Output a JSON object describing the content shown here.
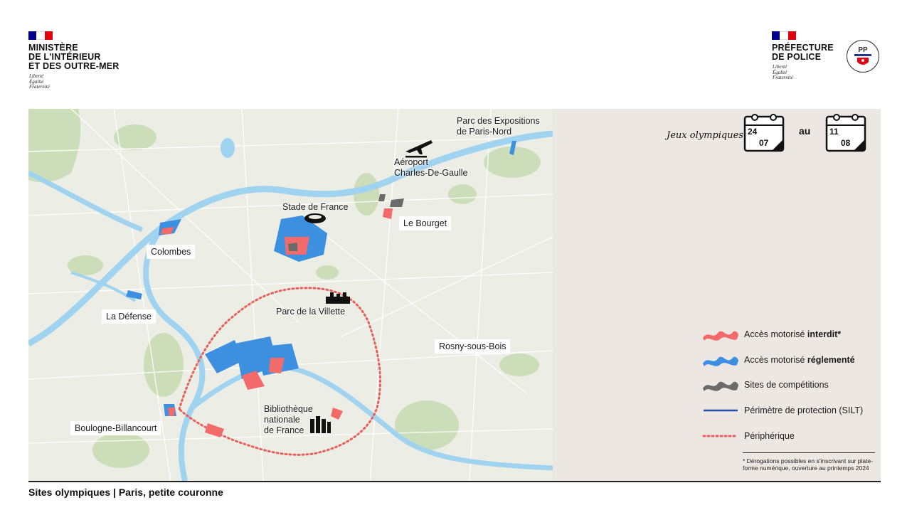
{
  "header": {
    "left": {
      "name_lines": [
        "MINISTÈRE",
        "DE L'INTÉRIEUR",
        "ET DES OUTRE-MER"
      ],
      "motto_lines": [
        "Liberté",
        "Égalité",
        "Fraternité"
      ]
    },
    "right": {
      "name_lines": [
        "PRÉFECTURE",
        "DE POLICE"
      ],
      "motto_lines": [
        "Liberté",
        "Égalité",
        "Fraternité"
      ],
      "logo_text": "PP"
    }
  },
  "dates": {
    "event_label": "Jeux olympiques",
    "connector": "au",
    "start": {
      "day": "24",
      "month": "07"
    },
    "end": {
      "day": "11",
      "month": "08"
    }
  },
  "map": {
    "labels": {
      "parc_expositions": [
        "Parc des Expositions",
        "de Paris-Nord"
      ],
      "aeroport": [
        "Aéroport",
        "Charles-De-Gaulle"
      ],
      "stade_de_france": "Stade de France",
      "le_bourget": "Le Bourget",
      "colombes": "Colombes",
      "la_defense": "La Défense",
      "parc_villette": "Parc de la Villette",
      "rosny": "Rosny-sous-Bois",
      "boulogne": "Boulogne-Billancourt",
      "bibliotheque": [
        "Bibliothèque",
        "nationale",
        "de France"
      ]
    }
  },
  "legend": [
    {
      "id": "interdit",
      "text": "Accès motorisé ",
      "bold": "interdit*",
      "color": "#f26a6a"
    },
    {
      "id": "reglemente",
      "text": "Accès motorisé ",
      "bold": "réglementé",
      "color": "#3d8fe0"
    },
    {
      "id": "competition",
      "text": "Sites de compétitions",
      "bold": "",
      "color": "#6b6b6b"
    },
    {
      "id": "silt",
      "text": "Périmètre de protection (SILT)",
      "bold": "",
      "color": "#1f4fa8"
    },
    {
      "id": "periph",
      "text": "Périphérique",
      "bold": "",
      "color": "#e8605c"
    }
  ],
  "footnote": "* Dérogations possibles en s'inscrivant sur plate-forme numérique, ouverture au printemps 2024",
  "footer": {
    "title": "Sites olympiques | Paris, petite couronne"
  }
}
